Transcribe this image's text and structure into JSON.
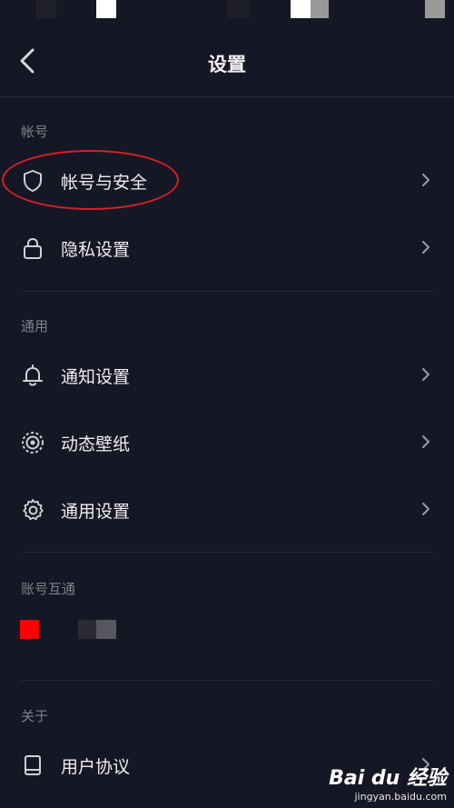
{
  "header": {
    "title": "设置"
  },
  "sections": [
    {
      "label": "帐号",
      "items": [
        {
          "label": "帐号与安全",
          "icon": "shield-icon"
        },
        {
          "label": "隐私设置",
          "icon": "lock-icon"
        }
      ]
    },
    {
      "label": "通用",
      "items": [
        {
          "label": "通知设置",
          "icon": "bell-icon"
        },
        {
          "label": "动态壁纸",
          "icon": "wallpaper-icon"
        },
        {
          "label": "通用设置",
          "icon": "gear-icon"
        }
      ]
    },
    {
      "label": "账号互通",
      "items": []
    },
    {
      "label": "关于",
      "items": [
        {
          "label": "用户协议",
          "icon": "book-icon"
        }
      ]
    }
  ],
  "watermark": {
    "logo": "Bai du 经验",
    "url": "jingyan.baidu.com"
  },
  "colors": {
    "background": "#161724",
    "highlight_oval": "#d42026",
    "linked_app_badge": "#ff0000"
  }
}
